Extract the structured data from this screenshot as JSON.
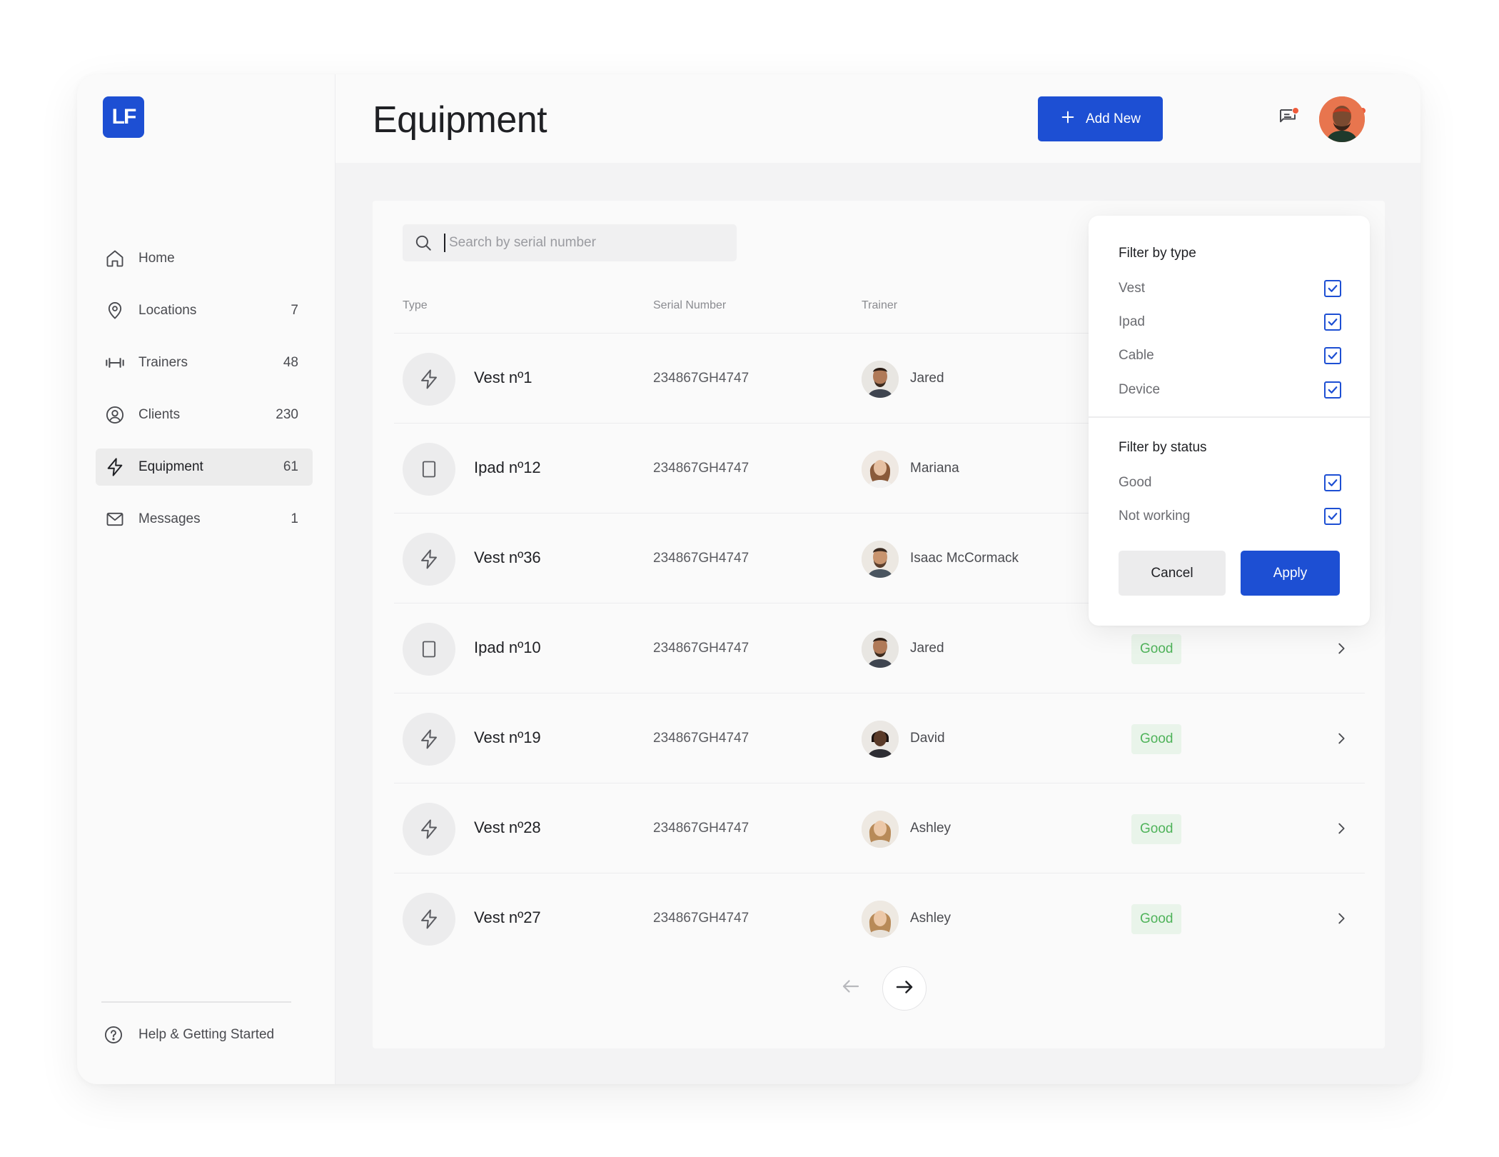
{
  "app": {
    "logo_text": "LF"
  },
  "sidebar": {
    "items": [
      {
        "label": "Home",
        "count": "",
        "icon": "home-icon"
      },
      {
        "label": "Locations",
        "count": "7",
        "icon": "map-pin-icon"
      },
      {
        "label": "Trainers",
        "count": "48",
        "icon": "dumbbell-icon"
      },
      {
        "label": "Clients",
        "count": "230",
        "icon": "user-circle-icon"
      },
      {
        "label": "Equipment",
        "count": "61",
        "icon": "bolt-icon",
        "active": true
      },
      {
        "label": "Messages",
        "count": "1",
        "icon": "mail-icon"
      }
    ],
    "help_label": "Help & Getting Started"
  },
  "header": {
    "title": "Equipment",
    "add_button_label": "Add New"
  },
  "search": {
    "placeholder": "Search by serial number",
    "value": ""
  },
  "table": {
    "columns": [
      "Type",
      "Serial Number",
      "Trainer"
    ],
    "rows": [
      {
        "type_icon": "bolt-icon",
        "name": "Vest nº1",
        "serial": "234867GH4747",
        "trainer": "Jared",
        "status": ""
      },
      {
        "type_icon": "tablet-icon",
        "name": "Ipad nº12",
        "serial": "234867GH4747",
        "trainer": "Mariana",
        "status": ""
      },
      {
        "type_icon": "bolt-icon",
        "name": "Vest nº36",
        "serial": "234867GH4747",
        "trainer": "Isaac McCormack",
        "status": ""
      },
      {
        "type_icon": "tablet-icon",
        "name": "Ipad nº10",
        "serial": "234867GH4747",
        "trainer": "Jared",
        "status": "Good"
      },
      {
        "type_icon": "bolt-icon",
        "name": "Vest nº19",
        "serial": "234867GH4747",
        "trainer": "David",
        "status": "Good"
      },
      {
        "type_icon": "bolt-icon",
        "name": "Vest nº28",
        "serial": "234867GH4747",
        "trainer": "Ashley",
        "status": "Good"
      },
      {
        "type_icon": "bolt-icon",
        "name": "Vest nº27",
        "serial": "234867GH4747",
        "trainer": "Ashley",
        "status": "Good"
      }
    ]
  },
  "filter": {
    "type_title": "Filter by type",
    "type_options": [
      {
        "label": "Vest",
        "checked": true
      },
      {
        "label": "Ipad",
        "checked": true
      },
      {
        "label": "Cable",
        "checked": true
      },
      {
        "label": "Device",
        "checked": true
      }
    ],
    "status_title": "Filter by status",
    "status_options": [
      {
        "label": "Good",
        "checked": true
      },
      {
        "label": "Not working",
        "checked": true
      }
    ],
    "cancel_label": "Cancel",
    "apply_label": "Apply"
  },
  "colors": {
    "accent": "#1d4fd3",
    "good_text": "#4fb35a",
    "good_bg": "#e9f4ea",
    "notification_dot": "#ef5b3b"
  }
}
